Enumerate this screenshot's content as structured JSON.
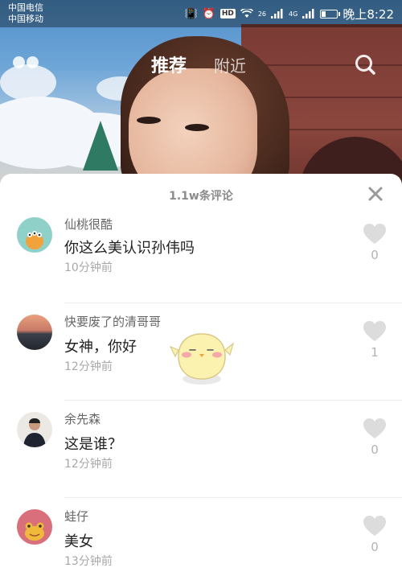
{
  "status_bar": {
    "carrier_1": "中国电信",
    "carrier_2": "中国移动",
    "network_1": "26",
    "network_2": "4G",
    "hd": "HD",
    "time": "晚上8:22",
    "battery_level": 0.3
  },
  "nav": {
    "tab_recommended": "推荐",
    "tab_nearby": "附近"
  },
  "comments_panel": {
    "title": "1.1w条评论",
    "comments": [
      {
        "user": "仙桃很酷",
        "text": "你这么美认识孙伟吗",
        "time": "10分钟前",
        "likes": "0",
        "avatar_color": "#8fd0c8"
      },
      {
        "user": "快要废了的清哥哥",
        "text": "女神，你好",
        "time": "12分钟前",
        "likes": "1",
        "avatar_color": "#3a3f4a"
      },
      {
        "user": "余先森",
        "text": "这是谁？",
        "time": "12分钟前",
        "likes": "0",
        "avatar_color": "#ece8e4"
      },
      {
        "user": "蛙仔",
        "text": "美女",
        "time": "13分钟前",
        "likes": "0",
        "avatar_color": "#d86f7a"
      }
    ]
  },
  "colors": {
    "sheet_bg": "#ffffff",
    "like_heart": "#dcdcdc",
    "secondary_text": "#a8a8a8"
  }
}
